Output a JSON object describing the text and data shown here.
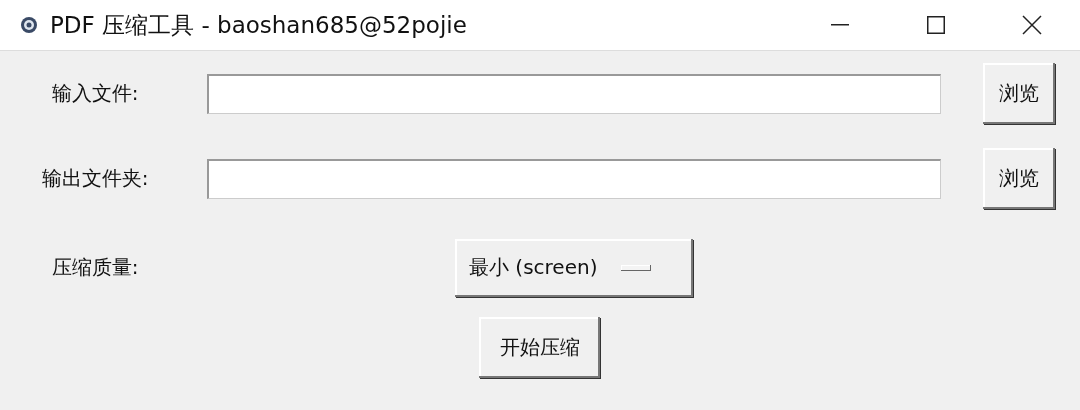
{
  "window": {
    "title": "PDF 压缩工具 - baoshan685@52pojie"
  },
  "fields": [
    {
      "label": "输入文件:",
      "button": "浏览"
    },
    {
      "label": "输出文件夹:",
      "button": "浏览"
    }
  ],
  "quality": {
    "label": "压缩质量:",
    "value": "最小 (screen)"
  },
  "start_button": "开始压缩"
}
